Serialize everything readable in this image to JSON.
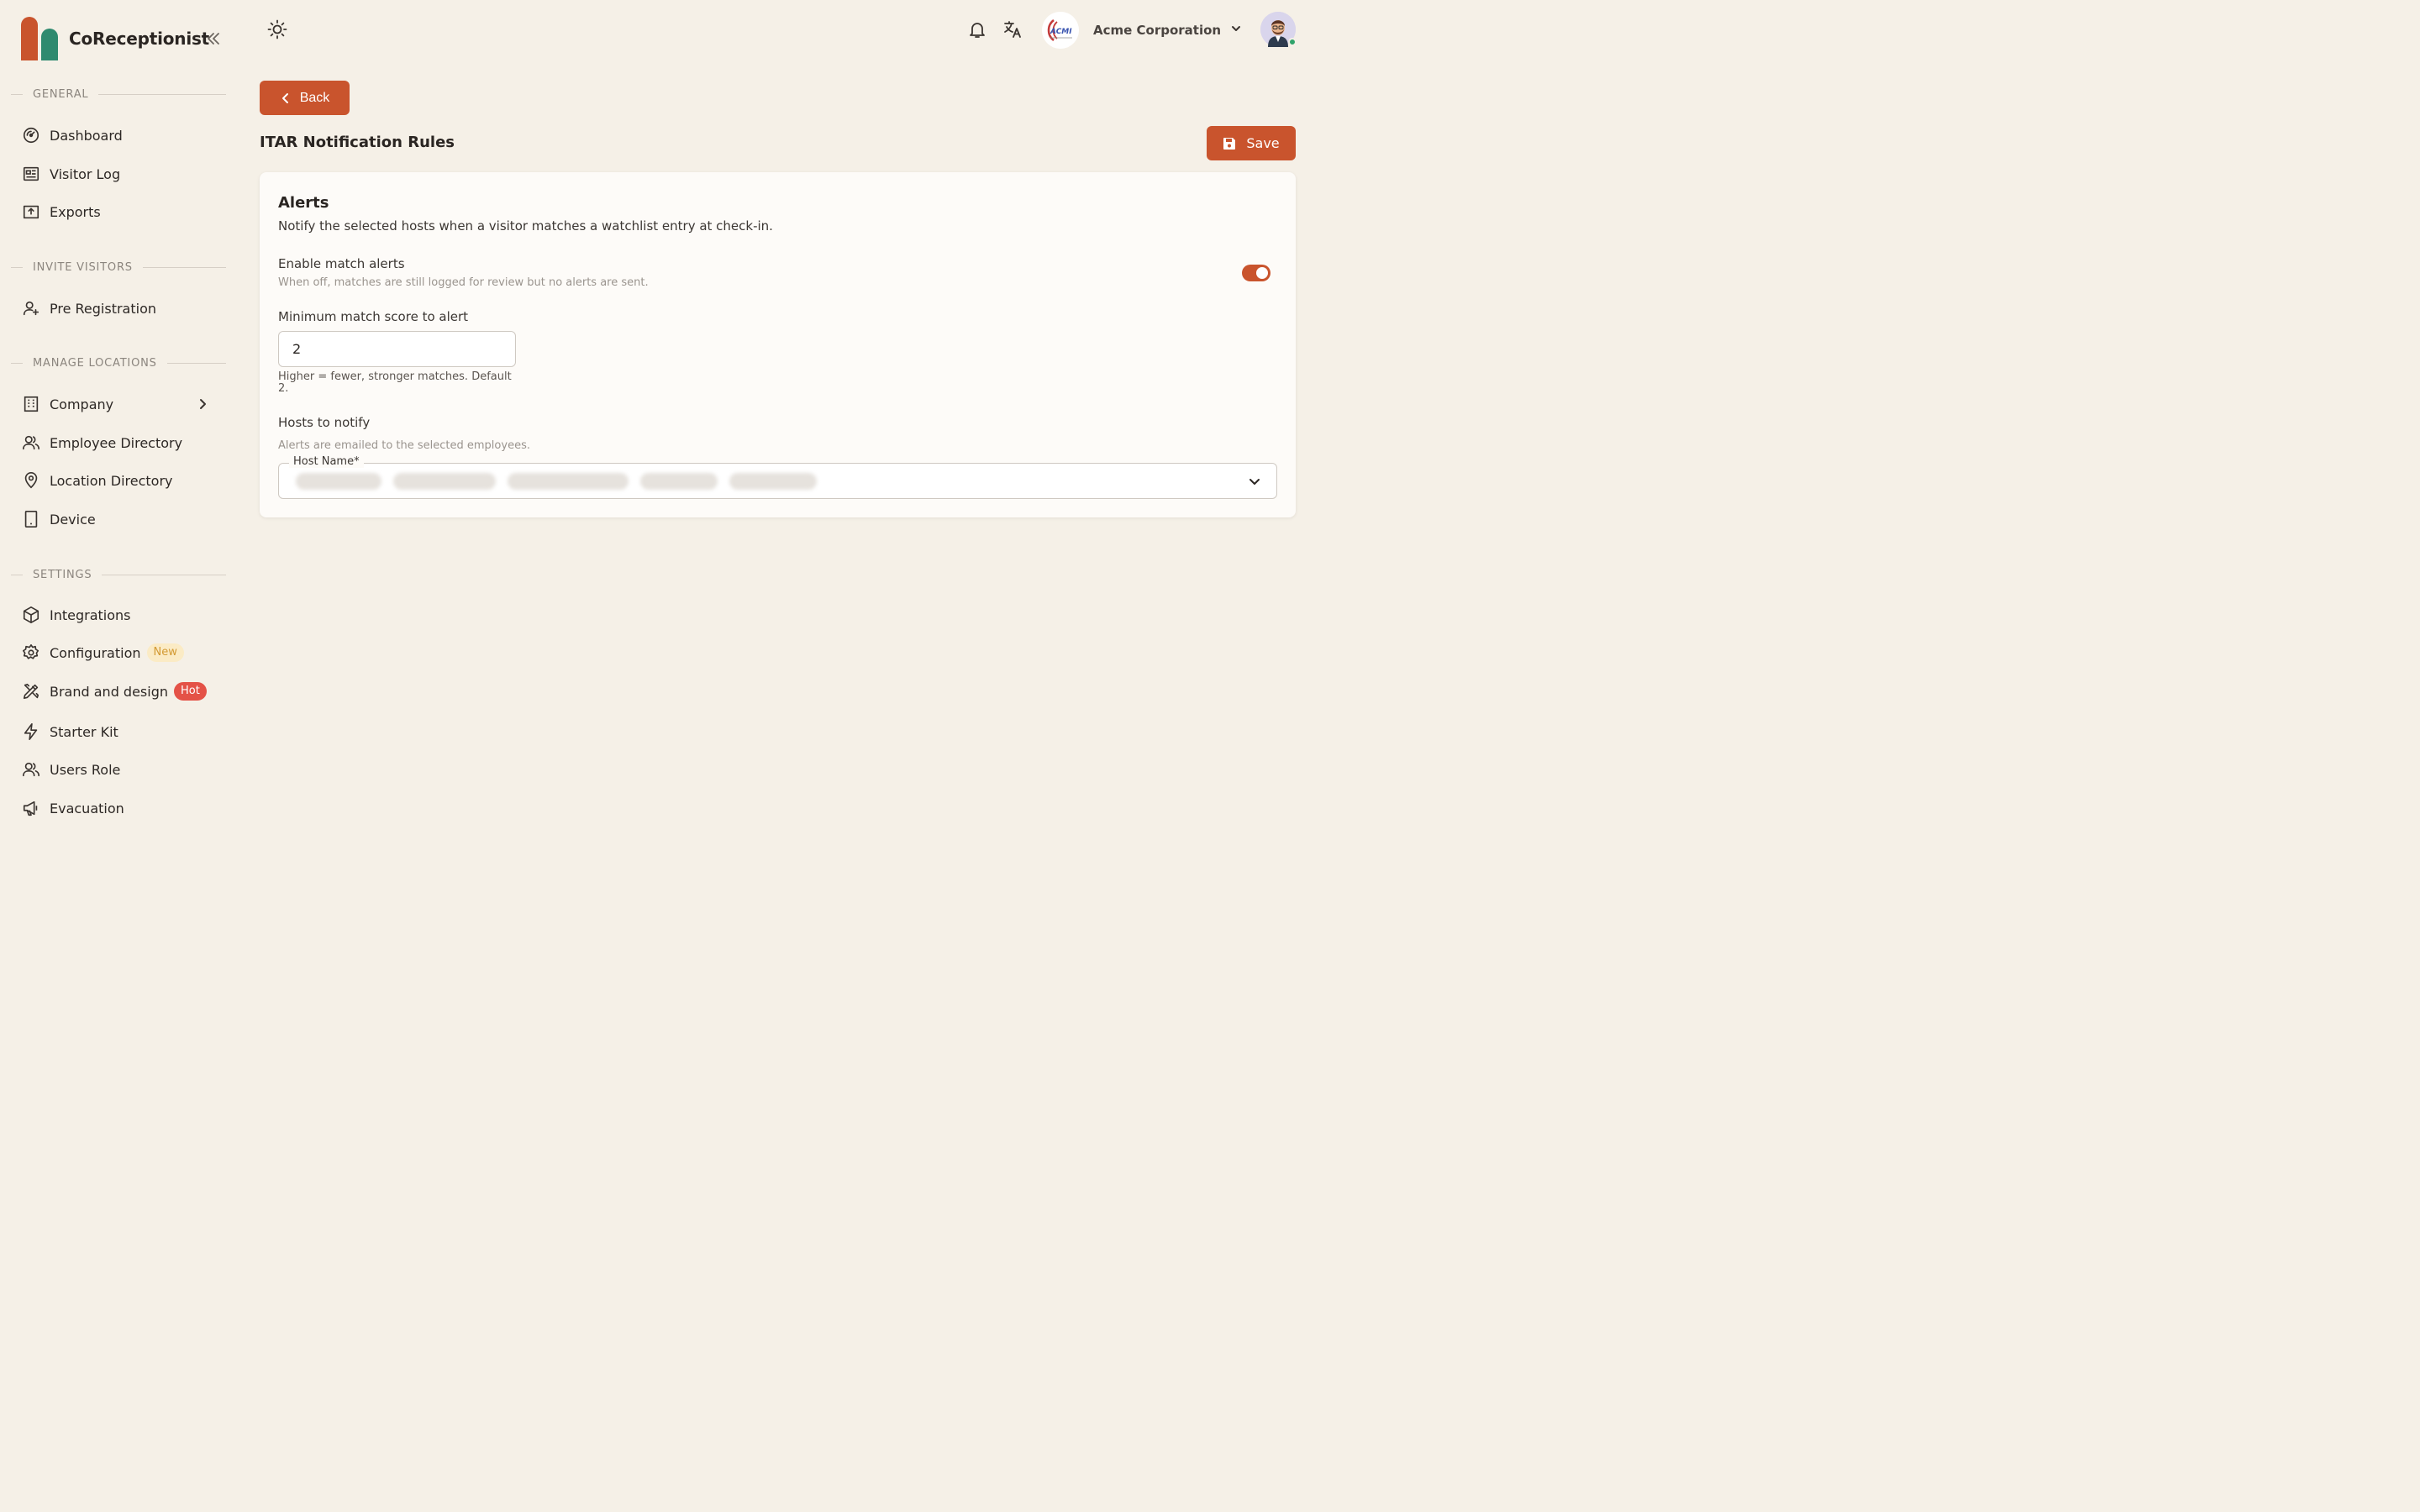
{
  "app": {
    "brand_name": "CoReceptionist",
    "brand_colors": {
      "left": "#c9542d",
      "right": "#2f8a6f"
    },
    "accent": "#c9542d"
  },
  "sidebar": {
    "sections": [
      {
        "label": "GENERAL"
      },
      {
        "label": "INVITE VISITORS"
      },
      {
        "label": "MANAGE LOCATIONS"
      },
      {
        "label": "SETTINGS"
      }
    ],
    "items": [
      {
        "label": "Dashboard",
        "icon": "gauge-icon"
      },
      {
        "label": "Visitor Log",
        "icon": "newspaper-icon"
      },
      {
        "label": "Exports",
        "icon": "export-icon"
      },
      {
        "label": "Pre Registration",
        "icon": "user-plus-icon"
      },
      {
        "label": "Company",
        "icon": "building-icon"
      },
      {
        "label": "Employee Directory",
        "icon": "users-icon"
      },
      {
        "label": "Location Directory",
        "icon": "map-pin-icon"
      },
      {
        "label": "Device",
        "icon": "tablet-icon"
      },
      {
        "label": "Integrations",
        "icon": "hexagon-icon"
      },
      {
        "label": "Configuration",
        "icon": "gear-icon",
        "badge": "New"
      },
      {
        "label": "Brand and design",
        "icon": "design-tools-icon",
        "badge": "Hot"
      },
      {
        "label": "Starter Kit",
        "icon": "bolt-icon"
      },
      {
        "label": "Users Role",
        "icon": "users-icon"
      },
      {
        "label": "Evacuation",
        "icon": "megaphone-icon"
      }
    ]
  },
  "topbar": {
    "org_name": "Acme Corporation",
    "org_logo_text": "ACMI"
  },
  "page": {
    "back_label": "Back",
    "title": "ITAR Notification Rules",
    "save_label": "Save"
  },
  "alerts_card": {
    "title": "Alerts",
    "description": "Notify the selected hosts when a visitor matches a watchlist entry at check-in.",
    "enable_label": "Enable match alerts",
    "enable_help": "When off, matches are still logged for review but no alerts are sent.",
    "enable_on": true,
    "score_label": "Minimum match score to alert",
    "score_value": "2",
    "score_help": "Higher = fewer, stronger matches. Default 2.",
    "hosts_label": "Hosts to notify",
    "hosts_help": "Alerts are emailed to the selected employees.",
    "host_field_label": "Host Name*",
    "host_chip_count": 5
  }
}
